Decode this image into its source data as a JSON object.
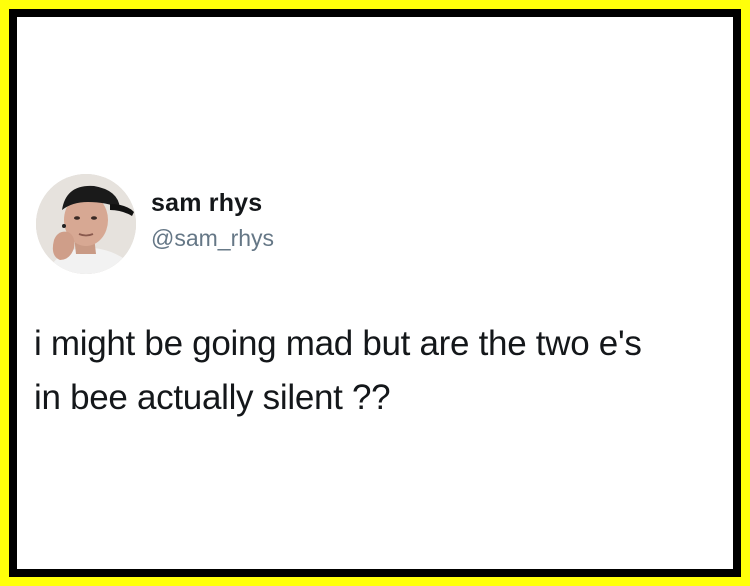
{
  "frame": {
    "outer_color": "#FFFF0A",
    "inner_color": "#000000",
    "background_color": "#FFFFFF"
  },
  "tweet": {
    "author": {
      "display_name": "sam rhys",
      "handle": "@sam_rhys",
      "avatar_icon": "profile-photo-icon"
    },
    "text_lines": [
      "i might be going mad but are the two e's",
      "in bee actually silent ??"
    ]
  }
}
